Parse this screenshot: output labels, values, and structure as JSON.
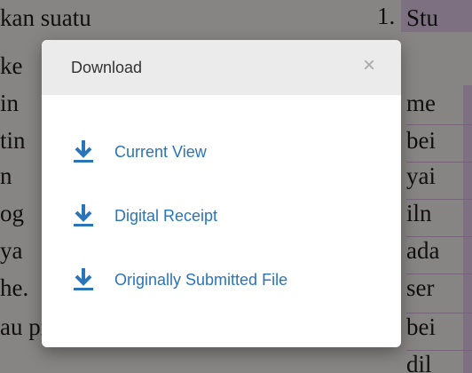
{
  "background_document": {
    "left_lines": [
      "kan  suatu",
      " ke",
      " in",
      "tin",
      "n",
      "og",
      "ya",
      "he.",
      "au  promo",
      ""
    ],
    "number": "1.",
    "right_lines": [
      "Stu",
      "me",
      "bei",
      "yai",
      "iln",
      "ada",
      "ser",
      "bei",
      "dil"
    ]
  },
  "modal": {
    "title": "Download",
    "close_label": "×",
    "options": [
      {
        "label": "Current View",
        "icon": "download-icon"
      },
      {
        "label": "Digital Receipt",
        "icon": "download-icon"
      },
      {
        "label": "Originally Submitted File",
        "icon": "download-icon"
      }
    ]
  },
  "colors": {
    "accent": "#2a74b9",
    "header_bg": "#ebebeb",
    "close_icon": "#a9a9a9"
  }
}
